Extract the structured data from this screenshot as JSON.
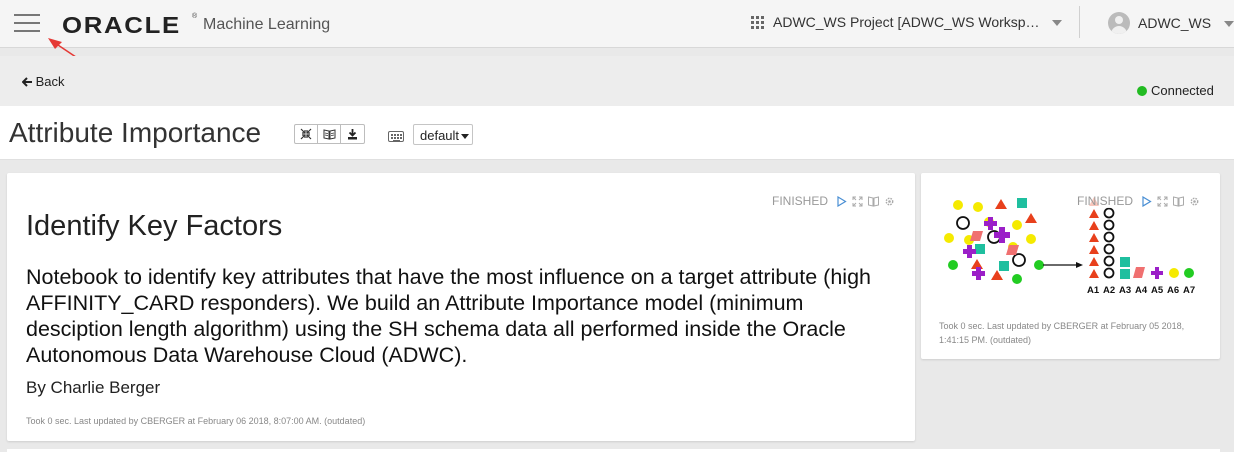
{
  "header": {
    "menu_icon": "hamburger-icon",
    "logo_text": "ORACLE",
    "logo_mark": "®",
    "app_name": "Machine Learning",
    "project_label": "ADWC_WS Project [ADWC_WS Workspace]",
    "user_name": "ADWC_WS"
  },
  "subheader": {
    "back_label": "Back",
    "status_label": "Connected",
    "status_color": "#22bb22"
  },
  "notebook": {
    "title": "Attribute Importance",
    "toolbar_icons": [
      "collapse-icon",
      "book-icon",
      "download-icon"
    ],
    "keyboard_icon": "keyboard-icon",
    "interpreter_select": "default"
  },
  "paragraphs": [
    {
      "status": "FINISHED",
      "heading": "Identify Key Factors",
      "body": "Notebook to identify key attributes that have the most influence on a target attribute (high AFFINITY_CARD responders). We build an Attribute Importance model (minimum desciption length algorithm) using the SH schema data all performed inside the Oracle Autonomous Data Warehouse Cloud (ADWC).",
      "byline": "By Charlie Berger",
      "meta": "Took 0 sec. Last updated by CBERGER at February 06 2018, 8:07:00 AM. (outdated)"
    },
    {
      "status": "FINISHED",
      "image_labels": [
        "A1",
        "A2",
        "A3",
        "A4",
        "A5",
        "A6",
        "A7"
      ],
      "meta": "Took 0 sec. Last updated by CBERGER at February 05 2018, 1:41:15 PM. (outdated)"
    }
  ]
}
